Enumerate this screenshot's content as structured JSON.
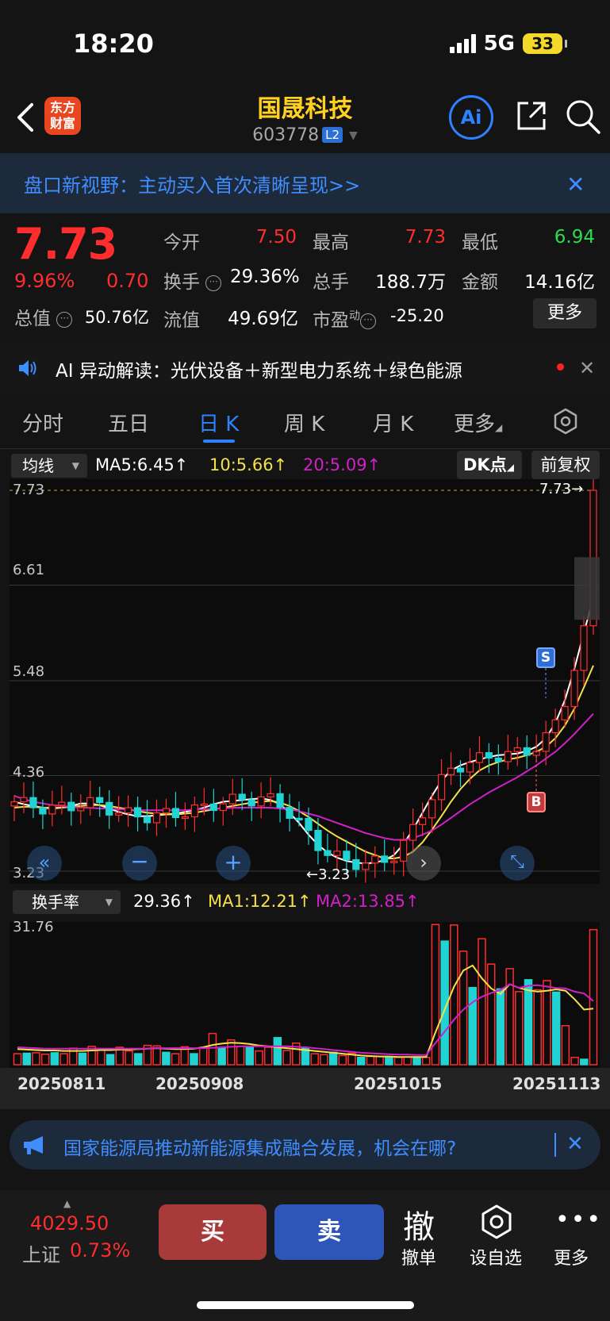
{
  "status": {
    "time": "18:20",
    "network": "5G",
    "battery": "33"
  },
  "header": {
    "logo": "东方财富",
    "stock_name": "国晟科技",
    "stock_code": "603778",
    "level_badge": "L2",
    "ai_label": "Ai"
  },
  "banner": {
    "text": "盘口新视野：主动买入首次清晰呈现>>",
    "close": "✕"
  },
  "quote": {
    "price": "7.73",
    "change_pct": "9.96%",
    "change_abs": "0.70",
    "open_label": "今开",
    "open": "7.50",
    "high_label": "最高",
    "high": "7.73",
    "low_label": "最低",
    "low": "6.94",
    "turnover_label": "换手",
    "turnover": "29.36%",
    "volume_label": "总手",
    "volume": "188.7万",
    "amount_label": "金额",
    "amount": "14.16亿",
    "mktcap_label": "总值",
    "mktcap": "50.76亿",
    "float_label": "流值",
    "float_cap": "49.69亿",
    "pe_label": "市盈",
    "pe_sup": "动",
    "pe": "-25.20",
    "more": "更多"
  },
  "ai_row": {
    "text": "AI 异动解读：光伏设备＋新型电力系统＋绿色能源",
    "close": "✕"
  },
  "tabs": [
    {
      "label": "分时"
    },
    {
      "label": "五日"
    },
    {
      "label": "日 K"
    },
    {
      "label": "周 K"
    },
    {
      "label": "月 K"
    },
    {
      "label": "更多"
    }
  ],
  "chart_controls": {
    "ma_select": "均线",
    "ma5": "MA5:6.45↑",
    "ma10": "10:5.66↑",
    "ma20": "20:5.09↑",
    "dk_button": "DK点",
    "restore_button": "前复权"
  },
  "colors": {
    "up": "#ff2d2d",
    "down": "#22d3d3",
    "ma5": "#ffffff",
    "ma10": "#f5e04a",
    "ma20": "#d020c8",
    "accent": "#2e82ff"
  },
  "chart_data": [
    {
      "type": "candlestick",
      "y_ticks": [
        "7.73",
        "6.61",
        "5.48",
        "4.36",
        "3.23"
      ],
      "ylim": [
        3.23,
        7.73
      ],
      "max_label": "7.73→",
      "min_label": "←3.23",
      "markers": {
        "sell": "S",
        "buy": "B"
      },
      "series": [
        {
          "name": "MA5",
          "values": [
            4.05,
            4.02,
            4.0,
            3.98,
            3.97,
            3.98,
            4.0,
            4.03,
            4.03,
            4.01,
            3.97,
            3.93,
            3.9,
            3.88,
            3.88,
            3.89,
            3.9,
            3.91,
            3.93,
            3.95,
            3.98,
            4.02,
            4.05,
            4.06,
            4.07,
            4.08,
            4.09,
            4.07,
            4.02,
            3.92,
            3.8,
            3.66,
            3.54,
            3.45,
            3.39,
            3.35,
            3.33,
            3.32,
            3.33,
            3.36,
            3.42,
            3.55,
            3.72,
            3.92,
            4.12,
            4.3,
            4.42,
            4.48,
            4.52,
            4.55,
            4.58,
            4.6,
            4.61,
            4.62,
            4.65,
            4.7,
            4.8,
            4.98,
            5.25,
            5.62,
            6.05,
            6.45
          ]
        },
        {
          "name": "MA10",
          "values": [
            3.98,
            3.99,
            3.99,
            3.98,
            3.98,
            3.98,
            3.99,
            4.0,
            4.01,
            4.01,
            4.0,
            3.98,
            3.96,
            3.94,
            3.92,
            3.91,
            3.9,
            3.9,
            3.91,
            3.92,
            3.94,
            3.96,
            3.98,
            4.0,
            4.02,
            4.04,
            4.05,
            4.06,
            4.04,
            4.0,
            3.94,
            3.87,
            3.79,
            3.71,
            3.64,
            3.58,
            3.52,
            3.46,
            3.42,
            3.38,
            3.38,
            3.4,
            3.46,
            3.57,
            3.72,
            3.88,
            4.05,
            4.2,
            4.32,
            4.42,
            4.48,
            4.52,
            4.55,
            4.57,
            4.6,
            4.64,
            4.7,
            4.8,
            4.95,
            5.15,
            5.4,
            5.66
          ]
        },
        {
          "name": "MA20",
          "values": [
            4.12,
            4.08,
            4.05,
            4.03,
            4.01,
            4.0,
            3.99,
            3.98,
            3.98,
            3.97,
            3.97,
            3.96,
            3.96,
            3.95,
            3.95,
            3.95,
            3.95,
            3.95,
            3.95,
            3.96,
            3.96,
            3.97,
            3.97,
            3.98,
            3.98,
            3.98,
            3.98,
            3.98,
            3.97,
            3.96,
            3.94,
            3.91,
            3.88,
            3.84,
            3.8,
            3.76,
            3.72,
            3.68,
            3.65,
            3.62,
            3.6,
            3.6,
            3.62,
            3.66,
            3.71,
            3.78,
            3.86,
            3.94,
            4.02,
            4.09,
            4.16,
            4.22,
            4.28,
            4.34,
            4.41,
            4.48,
            4.56,
            4.64,
            4.74,
            4.85,
            4.97,
            5.09
          ]
        }
      ]
    },
    {
      "type": "bar",
      "title": "换手率",
      "value_label": "29.36↑",
      "ma1_label": "MA1:12.21↑",
      "ma2_label": "MA2:13.85↑",
      "y_ticks": [
        "31.76"
      ],
      "ylim": [
        0,
        31.76
      ],
      "categories_shown": [
        "20250811",
        "20250908",
        "20251015",
        "20251113"
      ],
      "values": [
        2.4,
        2.5,
        2.6,
        2.3,
        2.6,
        2.4,
        3.6,
        2.5,
        4.0,
        3.4,
        2.2,
        3.8,
        3.0,
        2.4,
        4.2,
        4.1,
        2.7,
        2.4,
        3.9,
        2.4,
        3.7,
        6.8,
        3.7,
        5.4,
        4.0,
        3.8,
        3.0,
        3.8,
        5.9,
        3.1,
        4.7,
        3.6,
        2.4,
        2.2,
        2.7,
        2.0,
        2.5,
        1.6,
        1.8,
        1.8,
        1.6,
        1.6,
        1.7,
        1.5,
        1.6,
        30.5,
        26.9,
        30.4,
        24.7,
        16.8,
        27.4,
        21.9,
        16.5,
        20.9,
        15.9,
        18.5,
        16.3,
        18.3,
        15.8,
        8.5,
        1.6,
        1.2,
        29.4
      ],
      "series": [
        {
          "name": "MA1",
          "values": [
            3.4,
            3.3,
            3.2,
            3.1,
            3.1,
            3.0,
            3.0,
            3.0,
            3.1,
            3.2,
            3.2,
            3.3,
            3.3,
            3.4,
            3.5,
            3.6,
            3.5,
            3.4,
            3.4,
            3.5,
            3.8,
            4.3,
            4.6,
            4.8,
            4.7,
            4.5,
            4.2,
            4.0,
            3.8,
            3.6,
            3.4,
            3.2,
            3.0,
            2.8,
            2.6,
            2.4,
            2.2,
            2.0,
            1.9,
            1.8,
            1.8,
            1.7,
            1.7,
            1.7,
            1.7,
            7.0,
            12.0,
            17.0,
            20.5,
            21.6,
            18.8,
            16.6,
            15.4,
            17.5,
            16.7,
            16.2,
            15.9,
            16.1,
            16.4,
            16.1,
            14.2,
            12.0,
            12.2
          ]
        },
        {
          "name": "MA2",
          "values": [
            3.8,
            3.7,
            3.6,
            3.5,
            3.5,
            3.5,
            3.5,
            3.5,
            3.5,
            3.5,
            3.5,
            3.5,
            3.5,
            3.5,
            3.5,
            3.6,
            3.6,
            3.6,
            3.6,
            3.6,
            3.6,
            3.7,
            3.8,
            3.9,
            4.0,
            4.0,
            4.0,
            4.0,
            4.0,
            4.0,
            3.9,
            3.8,
            3.6,
            3.4,
            3.2,
            3.0,
            2.8,
            2.6,
            2.5,
            2.4,
            2.3,
            2.2,
            2.2,
            2.1,
            2.1,
            4.7,
            7.2,
            9.8,
            12.0,
            13.6,
            14.8,
            15.6,
            16.3,
            17.5,
            16.7,
            17.2,
            17.3,
            17.0,
            16.7,
            16.6,
            15.9,
            15.5,
            13.85
          ]
        }
      ]
    }
  ],
  "news": {
    "text": "国家能源局推动新能源集成融合发展，机会在哪?",
    "close": "✕"
  },
  "bottom": {
    "index_value": "4029.50",
    "index_name": "上证",
    "index_pct": "0.73%",
    "buy": "买",
    "sell": "卖",
    "cancel_glyph": "撤",
    "cancel_label": "撤单",
    "favorite_label": "设自选",
    "more_label": "更多"
  }
}
